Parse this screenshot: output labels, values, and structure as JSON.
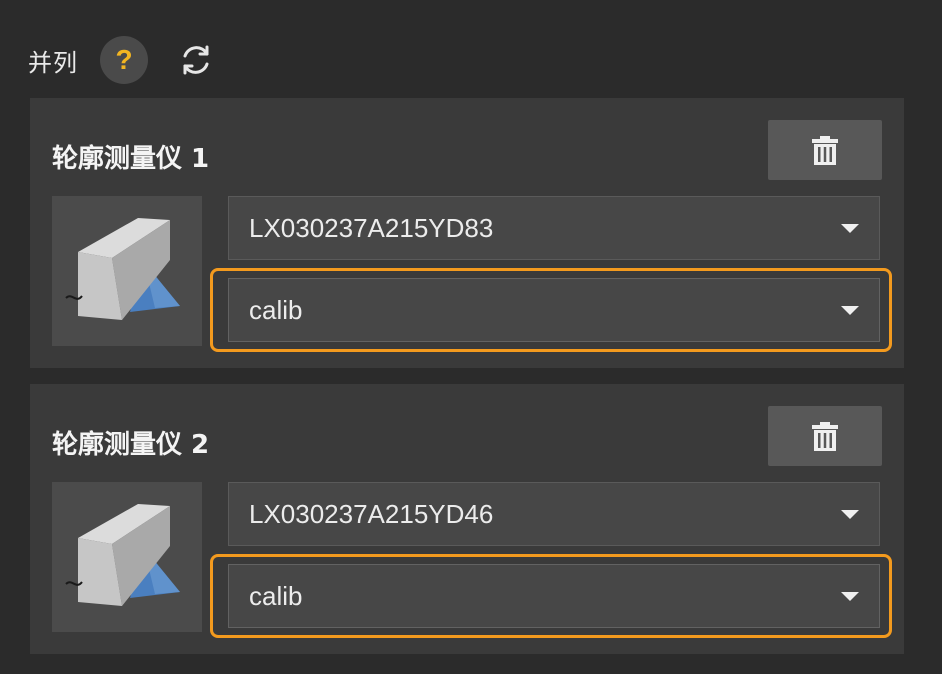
{
  "header": {
    "label": "并列",
    "help_icon": "question-mark-icon",
    "refresh_icon": "refresh-icon",
    "help_glyph": "?"
  },
  "colors": {
    "highlight": "#f39a1e",
    "help_accent": "#f2b521",
    "background": "#2b2b2b",
    "card": "#3a3a3a"
  },
  "profilers": [
    {
      "title": "轮廓测量仪 1",
      "serial": "LX030237A215YD83",
      "config": "calib",
      "delete_icon": "trash-icon",
      "thumbnail_icon": "laser-profiler-icon"
    },
    {
      "title": "轮廓测量仪 2",
      "serial": "LX030237A215YD46",
      "config": "calib",
      "delete_icon": "trash-icon",
      "thumbnail_icon": "laser-profiler-icon"
    }
  ]
}
